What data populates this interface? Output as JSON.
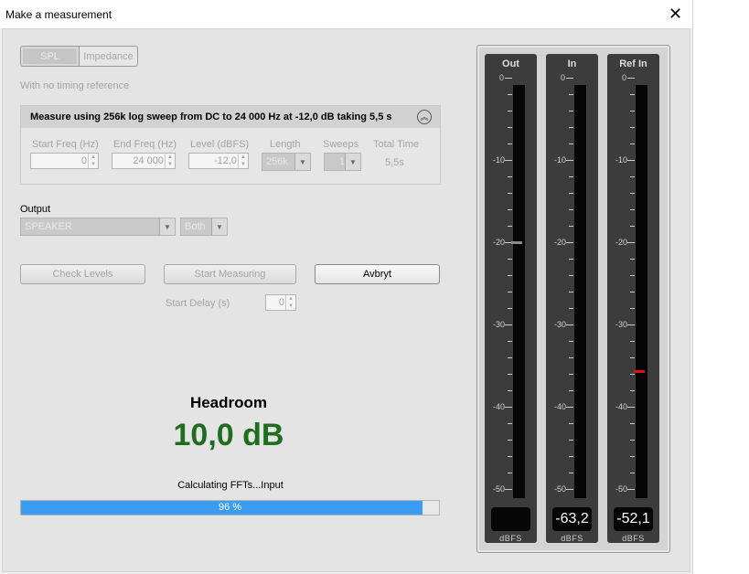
{
  "window": {
    "title": "Make a measurement"
  },
  "mode": {
    "options": [
      "SPL",
      "Impedance"
    ],
    "selected": "SPL"
  },
  "timing_note": "With no timing reference",
  "panel": {
    "heading": "Measure using  256k log sweep from DC to 24 000 Hz at -12,0 dB taking 5,5 s",
    "start_freq": {
      "label": "Start Freq (Hz)",
      "value": "0"
    },
    "end_freq": {
      "label": "End Freq (Hz)",
      "value": "24 000"
    },
    "level": {
      "label": "Level (dBFS)",
      "value": "-12,0"
    },
    "length": {
      "label": "Length",
      "value": "256k"
    },
    "sweeps": {
      "label": "Sweeps",
      "value": "1"
    },
    "total_time": {
      "label": "Total Time",
      "value": "5,5s"
    }
  },
  "output": {
    "label": "Output",
    "device": "SPEAKER",
    "channel": "Both"
  },
  "buttons": {
    "check_levels": "Check Levels",
    "start_measuring": "Start Measuring",
    "abort": "Avbryt"
  },
  "start_delay": {
    "label": "Start Delay (s)",
    "value": "0"
  },
  "headroom": {
    "label": "Headroom",
    "value": "10,0 dB"
  },
  "status": {
    "text": "Calculating FFTs...Input",
    "progress_percent": 96,
    "progress_label": "96 %"
  },
  "meters": {
    "scale": [
      "0",
      "-10",
      "-20",
      "-30",
      "-40",
      "-50"
    ],
    "unit": "dBFS",
    "channels": [
      {
        "name": "Out",
        "readout": "",
        "marker_db": -20,
        "marker_color": "#8c8c8c"
      },
      {
        "name": "In",
        "readout": "-63,2",
        "marker_db": null,
        "marker_color": ""
      },
      {
        "name": "Ref In",
        "readout": "-52,1",
        "marker_db": -35.7,
        "marker_color": "#e01010"
      }
    ]
  },
  "icons": {
    "close": "close-icon",
    "collapse": "chevrons-up-icon"
  }
}
